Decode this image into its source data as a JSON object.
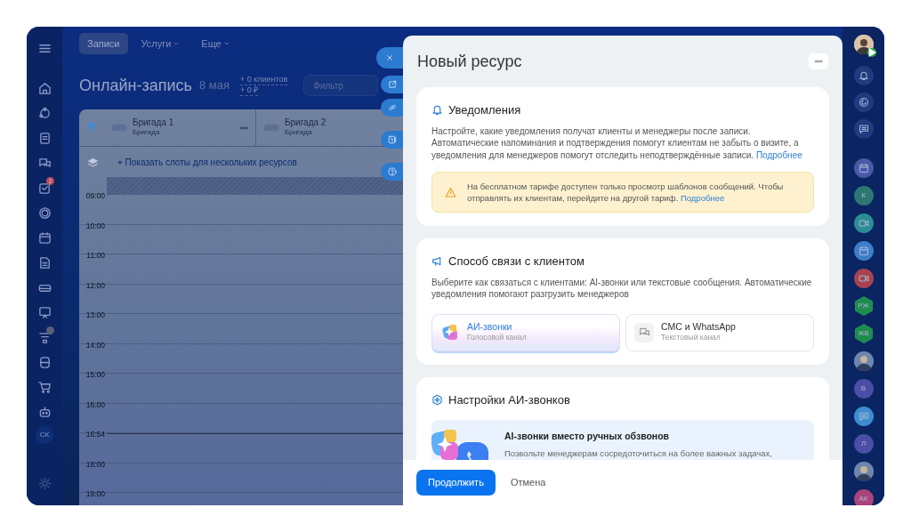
{
  "top_nav": [
    {
      "label": "Записи",
      "selected": true,
      "dropdown": false
    },
    {
      "label": "Услуги",
      "selected": false,
      "dropdown": true
    },
    {
      "label": "Еще",
      "selected": false,
      "dropdown": true
    }
  ],
  "sidebar": {
    "task_badge": "2",
    "user_initials": "СК"
  },
  "page": {
    "title": "Онлайн-запись",
    "date": "8 мая",
    "stats": [
      "+ 0 клиентов",
      "+ 0 ₽"
    ],
    "filter": {
      "placeholder": "Фильтр"
    }
  },
  "schedule": {
    "resources": [
      {
        "name": "Бригада 1",
        "type": "Бригада"
      },
      {
        "name": "Бригада 2",
        "type": "Бригада"
      }
    ],
    "show_slots_link": "+ Показать слоты для нескольких ресурсов",
    "rows": [
      {
        "kind": "hour",
        "time": "09:00"
      },
      {
        "kind": "hour",
        "time": "10:00"
      },
      {
        "kind": "hour",
        "time": "11:00"
      },
      {
        "kind": "hour",
        "time": "12:00"
      },
      {
        "kind": "hour",
        "time": "13:00"
      },
      {
        "kind": "hour",
        "time": "14:00"
      },
      {
        "kind": "hour",
        "time": "15:00"
      },
      {
        "kind": "hour",
        "time": "16:00"
      },
      {
        "kind": "now",
        "time": "16:54"
      },
      {
        "kind": "hour",
        "time": "18:00"
      },
      {
        "kind": "hour",
        "time": "19:00"
      }
    ]
  },
  "panel": {
    "title": "Новый ресурс",
    "notifications": {
      "title": "Уведомления",
      "text": "Настройте, какие уведомления получат клиенты и менеджеры после записи. Автоматические напоминания и подтверждения помогут клиентам не забыть о визите, а уведомления для менеджеров помогут отследить неподтверждённые записи.",
      "link": "Подробнее",
      "alert": {
        "text": "На бесплатном тарифе доступен только просмотр шаблонов сообщений. Чтобы отправлять их клиентам, перейдите на другой тариф.",
        "link": "Подробнее"
      }
    },
    "contact_method": {
      "title": "Способ связи с клиентом",
      "text": "Выберите как связаться с клиентами: AI-звонки или текстовые сообщения. Автоматические уведомления помогают разгрузить менеджеров",
      "options": [
        {
          "kind": "ai",
          "title": "АИ-звонки",
          "subtitle": "Голосовой канал",
          "selected": true
        },
        {
          "kind": "text",
          "title": "СМС и WhatsApp",
          "subtitle": "Текстовый канал",
          "selected": false
        }
      ]
    },
    "ai_settings": {
      "title": "Настройки АИ-звонков",
      "promo": {
        "title": "AI-звонки вместо ручных обзвонов",
        "text": "Позвольте менеджерам сосредоточиться на более важных задачах,"
      }
    },
    "buttons": {
      "primary": "Продолжить",
      "secondary": "Отмена"
    }
  },
  "right_rail": [
    {
      "kind": "calendar",
      "color": "#4b5aa6"
    },
    {
      "kind": "initials",
      "text": "К",
      "color": "#2d7772"
    },
    {
      "kind": "video",
      "color": "#2a8d93"
    },
    {
      "kind": "calendar",
      "color": "#3d7fc8"
    },
    {
      "kind": "video",
      "color": "#a8434f"
    },
    {
      "kind": "hex",
      "text": "РЖ",
      "color": "#1e8a4b"
    },
    {
      "kind": "hex",
      "text": "ЖВ",
      "color": "#1e8a4b"
    },
    {
      "kind": "photo"
    },
    {
      "kind": "initials",
      "text": "В",
      "color": "#4a4ea6"
    },
    {
      "kind": "chat",
      "color": "#3b8ed0"
    },
    {
      "kind": "initials",
      "text": "Л",
      "color": "#4a4ea6"
    },
    {
      "kind": "photo"
    },
    {
      "kind": "initials",
      "text": "АК",
      "color": "#ab4479"
    }
  ]
}
